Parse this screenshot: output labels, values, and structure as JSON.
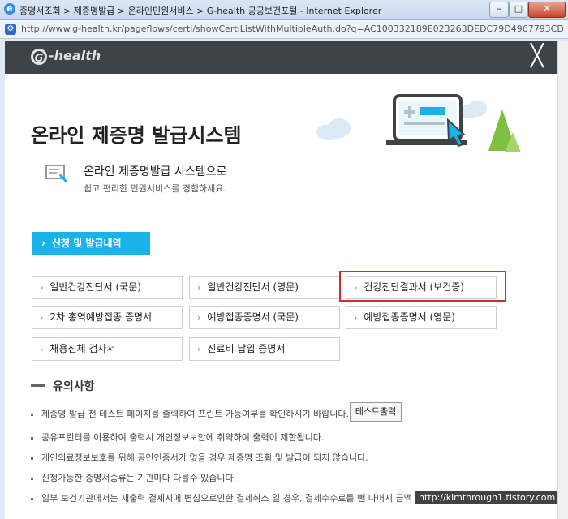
{
  "window": {
    "title": "증명서조회 > 제증명발급 > 온라인민원서비스 > G-health 공공보건포털 - Internet Explorer",
    "address": "http://www.g-health.kr/pageflows/certi/showCertiListWithMultipleAuth.do?q=AC100332189E023263DEDC79D4967793CDA7AA46B8F12&charse",
    "controls": {
      "min": "–",
      "max": "□",
      "close": "✕"
    }
  },
  "popup": {
    "logo_mark": "G",
    "logo_text": "-health",
    "close_symbol": "╳"
  },
  "hero": {
    "title": "온라인 제증명 발급시스템",
    "subtitle": "온라인 제증명발급 시스템으로",
    "description": "쉽고 편리한 민원서비스를 경험하세요."
  },
  "apply_button": {
    "chevron": "›",
    "label": "신청 및 발급내역"
  },
  "certificates": [
    {
      "label": "일반건강진단서 (국문)"
    },
    {
      "label": "일반건강진단서 (영문)"
    },
    {
      "label": "건강진단결과서 (보건증)"
    },
    {
      "label": "2차 홍역예방접종 증명서"
    },
    {
      "label": "예방접종증명서 (국문)"
    },
    {
      "label": "예방접종증명서 (영문)"
    },
    {
      "label": "채용신체 검사서"
    },
    {
      "label": "진료비 납입 증명서"
    }
  ],
  "chevron": "›",
  "notices": {
    "title": "유의사항",
    "items": [
      "제증명 발급 전 테스트 페이지를 출력하여 프린트 가능여부를 확인하시기 바랍니다.",
      "공유프린터를 이용하여 출력시 개인정보보안에 취약하여 출력이 제한됩니다.",
      "개인의료정보보호를 위해 공인인증서가 없을 경우 제증명 조회 및 발급이 되지 않습니다.",
      "신청가능한 증명서종류는 기관마다 다를수 있습니다.",
      "일부 보건기관에서는 재출력 결제시에 변심으로인한 결제취소 일 경우, 결제수수료를 뺀 나머지 금액"
    ],
    "test_button": "테스트출력"
  },
  "watermark": "http://kimthrough1.tistory.com",
  "colors": {
    "header_bg": "#3e4347",
    "accent": "#18b4e8",
    "highlight": "#d62b2b"
  }
}
